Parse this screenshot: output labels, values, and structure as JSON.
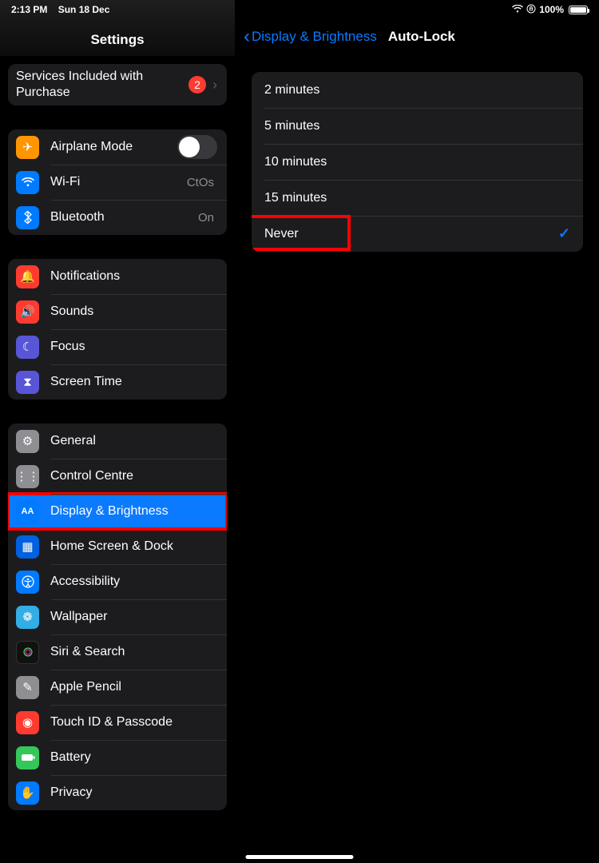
{
  "status": {
    "time": "2:13 PM",
    "date": "Sun 18 Dec",
    "battery_pct": "100%"
  },
  "sidebar": {
    "title": "Settings",
    "services": {
      "label": "Services Included with Purchase",
      "badge": "2"
    },
    "group_connectivity": [
      {
        "icon": "airplane",
        "label": "Airplane Mode",
        "toggle": false
      },
      {
        "icon": "wifi",
        "label": "Wi-Fi",
        "value": "CtOs"
      },
      {
        "icon": "bluetooth",
        "label": "Bluetooth",
        "value": "On"
      }
    ],
    "group_notifications": [
      {
        "icon": "bell",
        "label": "Notifications"
      },
      {
        "icon": "speaker",
        "label": "Sounds"
      },
      {
        "icon": "moon",
        "label": "Focus"
      },
      {
        "icon": "hourglass",
        "label": "Screen Time"
      }
    ],
    "group_general": [
      {
        "icon": "gear",
        "label": "General"
      },
      {
        "icon": "switches",
        "label": "Control Centre"
      },
      {
        "icon": "aa",
        "label": "Display & Brightness",
        "selected": true,
        "highlighted": true
      },
      {
        "icon": "grid",
        "label": "Home Screen & Dock"
      },
      {
        "icon": "person",
        "label": "Accessibility"
      },
      {
        "icon": "flower",
        "label": "Wallpaper"
      },
      {
        "icon": "siri",
        "label": "Siri & Search"
      },
      {
        "icon": "pencil",
        "label": "Apple Pencil"
      },
      {
        "icon": "fingerprint",
        "label": "Touch ID & Passcode"
      },
      {
        "icon": "battery",
        "label": "Battery"
      },
      {
        "icon": "hand",
        "label": "Privacy"
      }
    ]
  },
  "detail": {
    "back_label": "Display & Brightness",
    "title": "Auto-Lock",
    "options": [
      {
        "label": "2 minutes",
        "checked": false
      },
      {
        "label": "5 minutes",
        "checked": false
      },
      {
        "label": "10 minutes",
        "checked": false
      },
      {
        "label": "15 minutes",
        "checked": false
      },
      {
        "label": "Never",
        "checked": true,
        "highlighted": true
      }
    ]
  }
}
